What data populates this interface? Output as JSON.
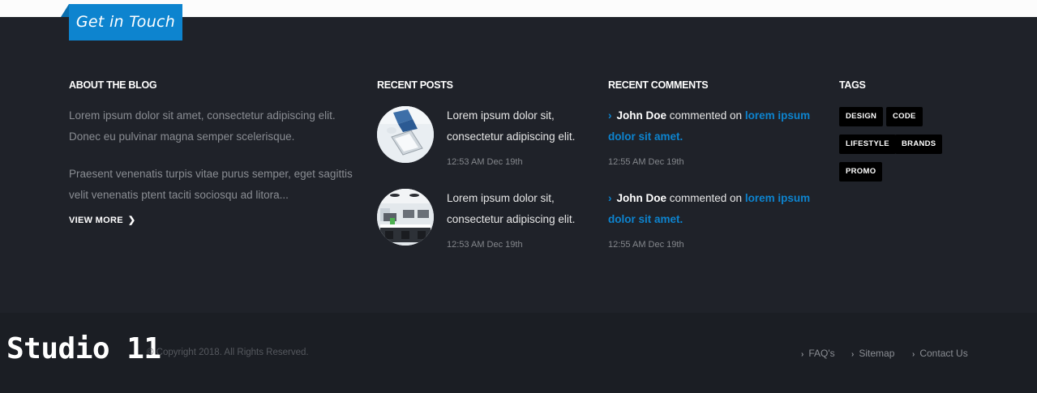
{
  "tab": {
    "label": "Get in Touch"
  },
  "about": {
    "title": "ABOUT THE BLOG",
    "para1_line1": "Lorem ipsum dolor sit amet, consectetur adipiscing elit.",
    "para1_line2": "Donec eu pulvinar magna semper scelerisque.",
    "para2_line1": "Praesent venenatis turpis vitae purus semper, eget sagittis",
    "para2_line2": "velit venenatis ptent taciti sociosqu ad litora...",
    "view_more": "VIEW MORE",
    "view_more_icon": "chevron-right-icon"
  },
  "recent_posts": {
    "title": "RECENT POSTS",
    "items": [
      {
        "line1": "Lorem ipsum dolor sit,",
        "line2": "consectetur adipiscing elit.",
        "time": "12:53 AM Dec 19th",
        "image": "laptop-desk-photo"
      },
      {
        "line1": "Lorem ipsum dolor sit,",
        "line2": "consectetur adipiscing elit.",
        "time": "12:53 AM Dec 19th",
        "image": "office-interior-photo"
      }
    ]
  },
  "recent_comments": {
    "title": "RECENT COMMENTS",
    "items": [
      {
        "author": "John Doe",
        "verb": " commented on ",
        "link_line1": "lorem ipsum",
        "link_line2": "dolor sit amet.",
        "time": "12:55 AM Dec 19th"
      },
      {
        "author": "John Doe",
        "verb": " commented on ",
        "link_line1": "lorem ipsum",
        "link_line2": "dolor sit amet.",
        "time": "12:55 AM Dec 19th"
      }
    ]
  },
  "tags": {
    "title": "TAGS",
    "items": [
      "DESIGN",
      "CODE",
      "LIFESTYLE",
      "BRANDS",
      "PROMO"
    ]
  },
  "bottom": {
    "logo": "Studio 11",
    "copyright": "© Copyright 2018. All Rights Reserved.",
    "links": [
      "FAQ's",
      "Sitemap",
      "Contact Us"
    ]
  },
  "colors": {
    "accent": "#0d84cf",
    "footer_bg": "#1f2229",
    "bottom_bg": "#1b1e24",
    "tag_bg": "#000000"
  }
}
